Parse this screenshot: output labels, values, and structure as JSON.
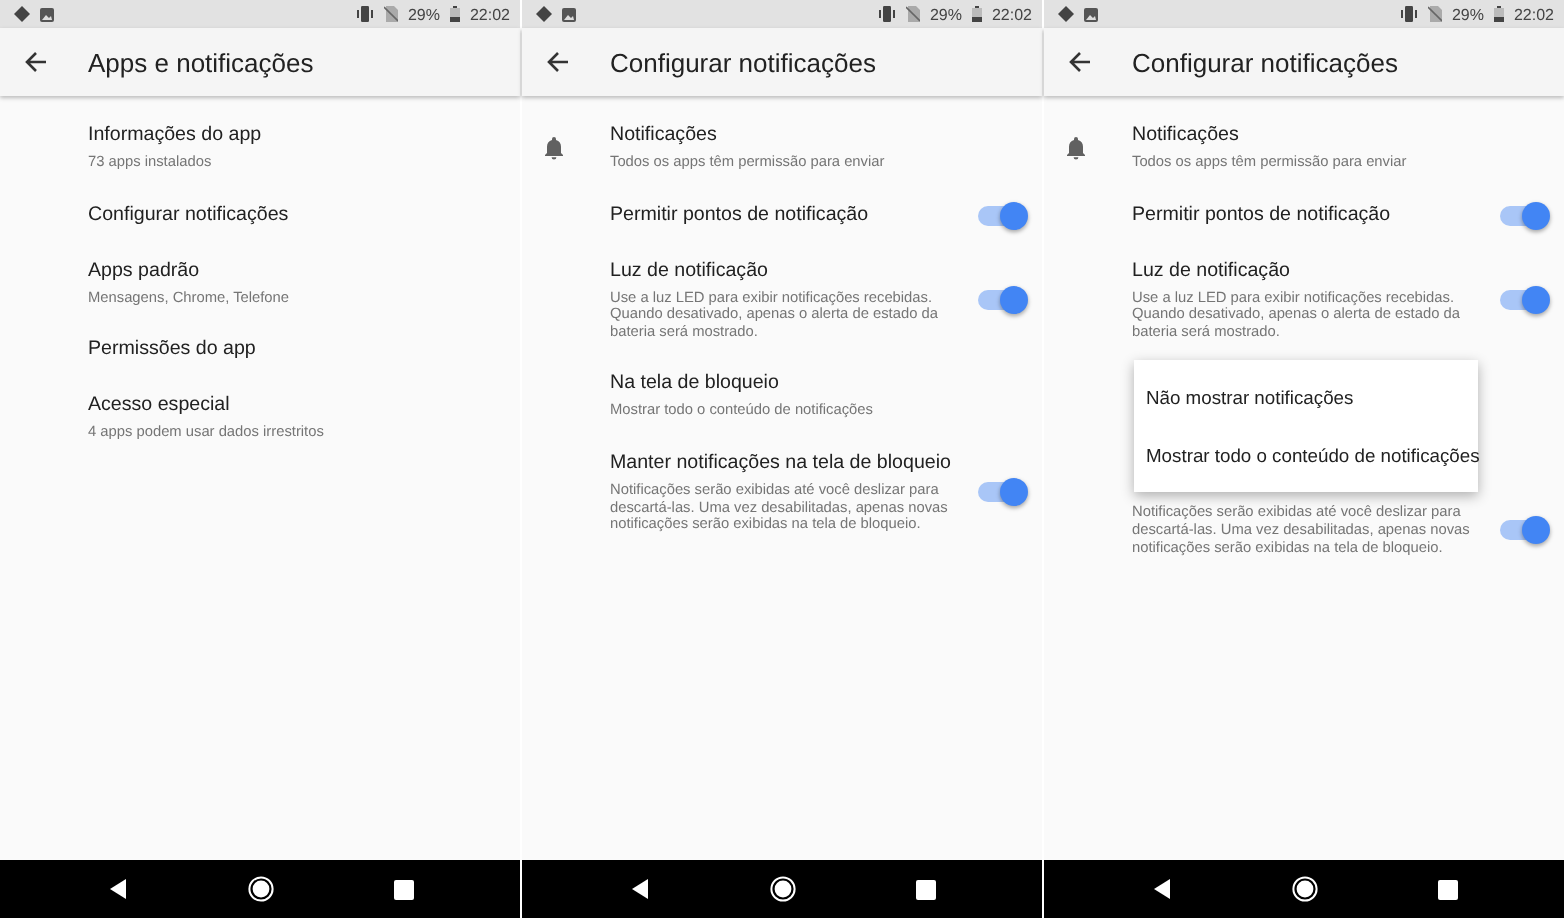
{
  "screens": [
    {
      "status": {
        "battery": "29%",
        "time": "22:02"
      },
      "title": "Apps e notificações",
      "items": [
        {
          "kind": "text",
          "title": "Informações do app",
          "subtitle": "73 apps instalados"
        },
        {
          "kind": "text",
          "title": "Configurar notificações"
        },
        {
          "kind": "text",
          "title": "Apps padrão",
          "subtitle": "Mensagens, Chrome, Telefone"
        },
        {
          "kind": "text",
          "title": "Permissões do app"
        },
        {
          "kind": "text",
          "title": "Acesso especial",
          "subtitle": "4 apps podem usar dados irrestritos"
        }
      ]
    },
    {
      "status": {
        "battery": "29%",
        "time": "22:02"
      },
      "title": "Configurar notificações",
      "items": [
        {
          "kind": "bell",
          "title": "Notificações",
          "subtitle": "Todos os apps têm permissão para enviar"
        },
        {
          "kind": "switch",
          "title": "Permitir pontos de notificação",
          "on": true
        },
        {
          "kind": "switch",
          "title": "Luz de notificação",
          "subtitle": "Use a luz LED para exibir notificações recebidas. Quando desativado, apenas o alerta de estado da bateria será mostrado.",
          "on": true
        },
        {
          "kind": "text",
          "title": "Na tela de bloqueio",
          "subtitle": "Mostrar todo o conteúdo de notificações"
        },
        {
          "kind": "switch",
          "title": "Manter notificações na tela de bloqueio",
          "subtitle": "Notificações serão exibidas até você deslizar para descartá-las. Uma vez desabilitadas, apenas novas notificações serão exibidas na tela de bloqueio.",
          "on": true
        }
      ]
    },
    {
      "status": {
        "battery": "29%",
        "time": "22:02"
      },
      "title": "Configurar notificações",
      "items": [
        {
          "kind": "bell",
          "title": "Notificações",
          "subtitle": "Todos os apps têm permissão para enviar"
        },
        {
          "kind": "switch",
          "title": "Permitir pontos de notificação",
          "on": true
        },
        {
          "kind": "switch",
          "title": "Luz de notificação",
          "subtitle": "Use a luz LED para exibir notificações recebidas. Quando desativado, apenas o alerta de estado da bateria será mostrado.",
          "on": true
        },
        {
          "kind": "menu",
          "options": [
            "Não mostrar notificações",
            "Mostrar todo o conteúdo de notificações"
          ]
        },
        {
          "kind": "switch",
          "subtitle": "Notificações serão exibidas até você deslizar para descartá-las. Uma vez desabilitadas, apenas novas notificações serão exibidas na tela de bloqueio.",
          "on": true
        }
      ]
    }
  ]
}
